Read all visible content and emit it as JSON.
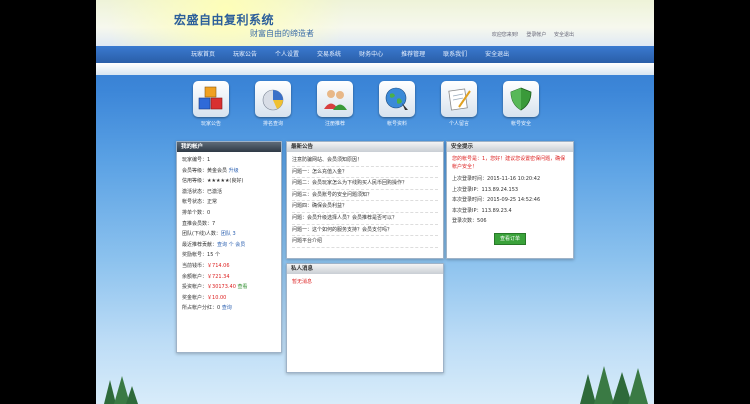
{
  "header": {
    "title": "宏盛自由复利系统",
    "slogan": "财富自由的缔造者",
    "user_links": [
      "欢迎您来到!",
      "登录帐户",
      "安全退出"
    ]
  },
  "nav": {
    "items": [
      "玩家首页",
      "玩家公告",
      "个人设置",
      "交易系统",
      "财务中心",
      "推荐管理",
      "联系我们",
      "安全退出"
    ]
  },
  "icons": [
    {
      "label": "玩家公告",
      "icon": "cubes-icon"
    },
    {
      "label": "排名查询",
      "icon": "pie-chart-icon"
    },
    {
      "label": "注册推荐",
      "icon": "users-icon"
    },
    {
      "label": "帐号资料",
      "icon": "globe-icon"
    },
    {
      "label": "个人留言",
      "icon": "notepad-icon"
    },
    {
      "label": "帐号安全",
      "icon": "shield-icon"
    }
  ],
  "user_panel": {
    "title": "我的帐户",
    "rows": [
      {
        "label": "玩家编号：",
        "value": "1"
      },
      {
        "label": "会员等级：",
        "value": "黄金会员",
        "extra": "升级"
      },
      {
        "label": "信用等级：",
        "value": "★★★★★(良好)"
      },
      {
        "label": "激活状态：",
        "value": "已激活"
      },
      {
        "label": "帐号状态：",
        "value": "正常"
      },
      {
        "label": "排单个数：",
        "value": "0"
      },
      {
        "label": "直推会员数：",
        "value": "7"
      },
      {
        "label": "团队(下线)人数：",
        "value": "团队 3"
      },
      {
        "label": "最近推荐贡献：",
        "value": "查询 个 会员"
      },
      {
        "label": "奖励帐号：",
        "value": "15 个"
      },
      {
        "label": "当前钱币：",
        "value": "￥714.06"
      },
      {
        "label": "余额帐户：",
        "value": "￥721.34"
      },
      {
        "label": "投资帐户：",
        "value": "￥30173.40",
        "extra": "查看"
      },
      {
        "label": "奖金帐户：",
        "value": "￥10.00"
      },
      {
        "label": "所占帐户分红：",
        "value": "0",
        "extra": "查询"
      }
    ]
  },
  "announcements": {
    "title": "最新公告",
    "items": [
      "注意防骗网站、会员须知原因！",
      "问题一：怎么充值入金？",
      "问题二：会员玩家怎么为下线购买人民币回购操作？",
      "问题三：会员账号的安全问题须知？",
      "问题四：确保会员利益？",
      "问题：会员升级选择人员？会员推荐是否可以？",
      "问题一：这个如何的服务支持？会员支付吗？",
      "问题平台介绍"
    ]
  },
  "messages": {
    "title": "私人消息",
    "items": [
      "暂无消息"
    ]
  },
  "security_panel": {
    "title": "安全提示",
    "warning": "您的帐号是：1，您好！建议您设置密保问题，确保帐户安全！",
    "rows": [
      {
        "label": "上次登录时间：",
        "value": "2015-11-16 10:20:42"
      },
      {
        "label": "上次登录IP：",
        "value": "113.89.24.153"
      },
      {
        "label": "本次登录时间：",
        "value": "2015-09-25 14:52:46"
      },
      {
        "label": "本次登录IP：",
        "value": "113.89.23.4"
      },
      {
        "label": "登录次数：",
        "value": "506"
      }
    ],
    "button": "查看订单"
  }
}
